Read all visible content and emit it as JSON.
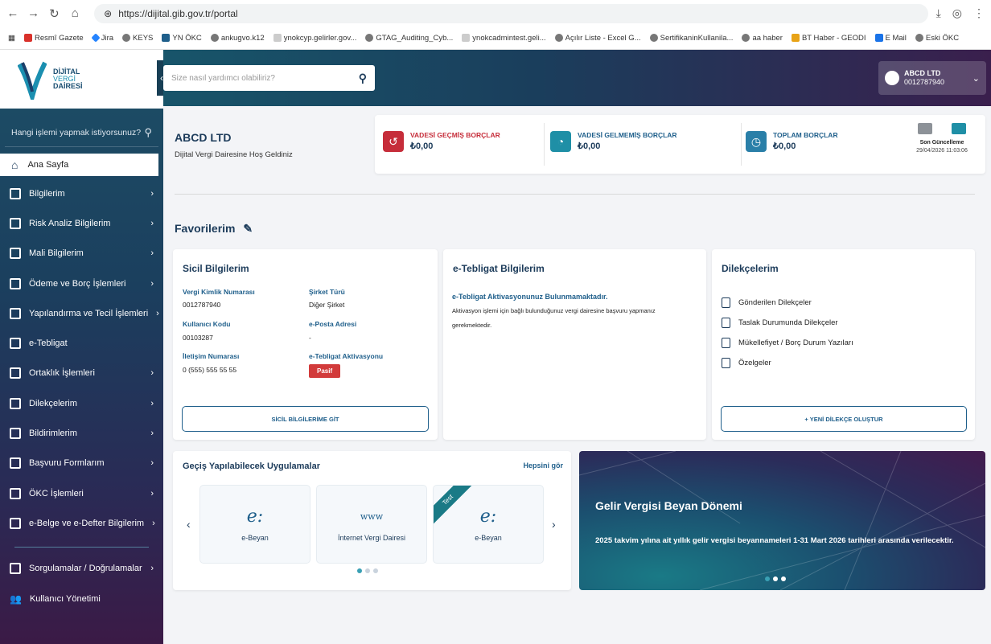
{
  "browser": {
    "url": "https://dijital.gib.gov.tr/portal",
    "bookmarks": [
      "Resmî Gazete",
      "Jira",
      "KEYS",
      "YN ÖKC",
      "ankugvo.k12",
      "ynokcyp.gelirler.gov...",
      "GTAG_Auditing_Cyb...",
      "ynokcadmintest.geli...",
      "Açılır Liste - Excel G...",
      "SertifikaninKullanila...",
      "aa haber",
      "BT Haber - GEODI",
      "E Mail",
      "Eski ÖKC"
    ]
  },
  "logo": {
    "line1": "DİJİTAL",
    "line2": "VERGİ",
    "line3": "DAİRESİ"
  },
  "sidebar": {
    "search_placeholder": "Hangi işlemi yapmak istiyorsunuz?",
    "home": "Ana Sayfa",
    "items": [
      {
        "label": "Bilgilerim",
        "icon": "id-card-icon"
      },
      {
        "label": "Risk Analiz Bilgilerim",
        "icon": "risk-analysis-icon"
      },
      {
        "label": "Mali Bilgilerim",
        "icon": "chart-icon"
      },
      {
        "label": "Ödeme ve Borç İşlemleri",
        "icon": "card-icon"
      },
      {
        "label": "Yapılandırma ve Tecil İşlemleri",
        "icon": "money-icon"
      },
      {
        "label": "e-Tebligat",
        "icon": "mail-icon"
      },
      {
        "label": "Ortaklık İşlemleri",
        "icon": "handshake-icon"
      },
      {
        "label": "Dilekçelerim",
        "icon": "book-icon"
      },
      {
        "label": "Bildirimlerim",
        "icon": "bookmark-icon"
      },
      {
        "label": "Başvuru Formlarım",
        "icon": "document-icon"
      },
      {
        "label": "ÖKC İşlemleri",
        "icon": "calculator-icon"
      },
      {
        "label": "e-Belge ve e-Defter Bilgilerim",
        "icon": "invoice-icon"
      }
    ],
    "bottom": [
      {
        "label": "Sorgulamalar / Doğrulamalar",
        "icon": "query-icon"
      },
      {
        "label": "Kullanıcı Yönetimi",
        "icon": "users-icon"
      }
    ]
  },
  "header": {
    "search_placeholder": "Size nasıl yardımcı olabiliriz?",
    "user_name": "ABCD LTD",
    "user_id": "0012787940"
  },
  "summary": {
    "company": "ABCD LTD",
    "welcome": "Dijital Vergi Dairesine Hoş Geldiniz",
    "overdue_label": "VADESİ GEÇMİŞ BORÇLAR",
    "overdue_value": "₺0,00",
    "notdue_label": "VADESİ GELMEMİŞ BORÇLAR",
    "notdue_value": "₺0,00",
    "total_label": "TOPLAM BORÇLAR",
    "total_value": "₺0,00",
    "last_update_label": "Son Güncelleme",
    "last_update_value": "29/04/2026 11:03:06",
    "colors": {
      "overdue": "#c62d3a",
      "notdue": "#1f8fa6",
      "total": "#2a7fa8"
    }
  },
  "favorites_title": "Favorilerim",
  "sicil": {
    "title": "Sicil Bilgilerim",
    "vkn_label": "Vergi Kimlik Numarası",
    "vkn_value": "0012787940",
    "type_label": "Şirket Türü",
    "type_value": "Diğer Şirket",
    "user_code_label": "Kullanıcı Kodu",
    "user_code_value": "00103287",
    "email_label": "e-Posta Adresi",
    "email_value": "-",
    "phone_label": "İletişim Numarası",
    "phone_value": "0 (555) 555 55 55",
    "etebligat_label": "e-Tebligat Aktivasyonu",
    "etebligat_value": "Pasif",
    "button": "SİCİL BİLGİLERİME GİT"
  },
  "tebligat": {
    "title": "e-Tebligat Bilgilerim",
    "warning": "e-Tebligat Aktivasyonunuz Bulunmamaktadır.",
    "text1": "Aktivasyon işlemi için bağlı bulunduğunuz vergi dairesine başvuru yapmanız",
    "text2": "gerekmektedir."
  },
  "dilekce": {
    "title": "Dilekçelerim",
    "items": [
      "Gönderilen Dilekçeler",
      "Taslak Durumunda Dilekçeler",
      "Mükellefiyet / Borç Durum Yazıları",
      "Özelgeler"
    ],
    "button": "+ YENİ DİLEKÇE OLUŞTUR"
  },
  "apps": {
    "title": "Geçiş Yapılabilecek Uygulamalar",
    "see_all": "Hepsini gör",
    "tiles": [
      {
        "name": "e-Beyan",
        "logo": "e:",
        "ribbon": ""
      },
      {
        "name": "İnternet Vergi Dairesi",
        "logo": "www",
        "ribbon": ""
      },
      {
        "name": "e-Beyan",
        "logo": "e:",
        "ribbon": "Test"
      }
    ]
  },
  "banner": {
    "title": "Gelir Vergisi Beyan Dönemi",
    "text": "2025 takvim yılına ait yıllık gelir vergisi beyannameleri 1-31 Mart 2026 tarihleri arasında verilecektir."
  }
}
